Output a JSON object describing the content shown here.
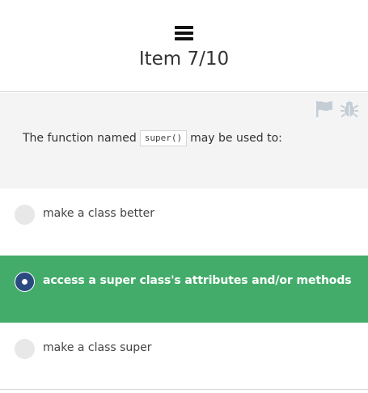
{
  "header": {
    "menu_icon": "hamburger-menu-icon",
    "title": "Item 7/10"
  },
  "question": {
    "flag_icon": "flag-icon",
    "bug_icon": "bug-icon",
    "text_before": "The function named",
    "code": "super()",
    "text_after": "may be used to:"
  },
  "options": [
    {
      "label": "make a class better",
      "selected": false
    },
    {
      "label": "access a super class's attributes and/or methods",
      "selected": true
    },
    {
      "label": "make a class super",
      "selected": false
    }
  ],
  "colors": {
    "selected_background": "#43ac6a",
    "selected_radio": "#2b4a7f",
    "question_background": "#f4f4f4"
  }
}
